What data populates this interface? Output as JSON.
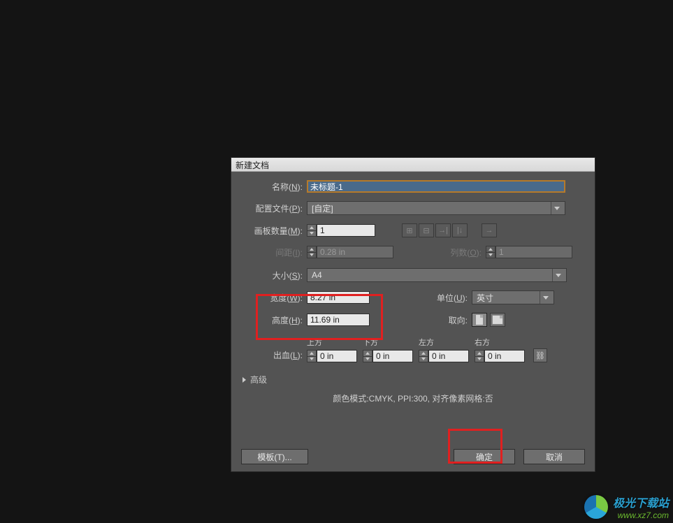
{
  "dialog": {
    "title": "新建文档",
    "name_label_pre": "名称(",
    "name_mn": "N",
    "name_label_post": "):",
    "name_value": "未标题-1",
    "profile_label_pre": "配置文件(",
    "profile_mn": "P",
    "profile_label_post": "):",
    "profile_value": "[自定]",
    "artboards_label_pre": "画板数量(",
    "artboards_mn": "M",
    "artboards_label_post": "):",
    "artboards_value": "1",
    "spacing_label_pre": "间距(",
    "spacing_mn": "I",
    "spacing_label_post": "):",
    "spacing_value": "0.28 in",
    "columns_label_pre": "列数(",
    "columns_mn": "O",
    "columns_label_post": "):",
    "columns_value": "1",
    "size_label_pre": "大小(",
    "size_mn": "S",
    "size_label_post": "):",
    "size_value": "A4",
    "width_label_pre": "宽度(",
    "width_mn": "W",
    "width_label_post": "):",
    "width_value": "8.27 in",
    "height_label_pre": "高度(",
    "height_mn": "H",
    "height_label_post": "):",
    "height_value": "11.69 in",
    "units_label_pre": "单位(",
    "units_mn": "U",
    "units_label_post": "):",
    "units_value": "英寸",
    "orientation_label": "取向:",
    "bleed_label_pre": "出血(",
    "bleed_mn": "L",
    "bleed_label_post": "):",
    "bleed_top": "上方",
    "bleed_bottom": "下方",
    "bleed_left": "左方",
    "bleed_right": "右方",
    "bleed_value": "0 in",
    "advanced": "高级",
    "info": "颜色模式:CMYK, PPI:300, 对齐像素网格:否",
    "template_btn": "模板(T)...",
    "ok_btn": "确定",
    "cancel_btn": "取消"
  },
  "watermark": {
    "cn": "极光下载站",
    "url": "www.xz7.com"
  }
}
